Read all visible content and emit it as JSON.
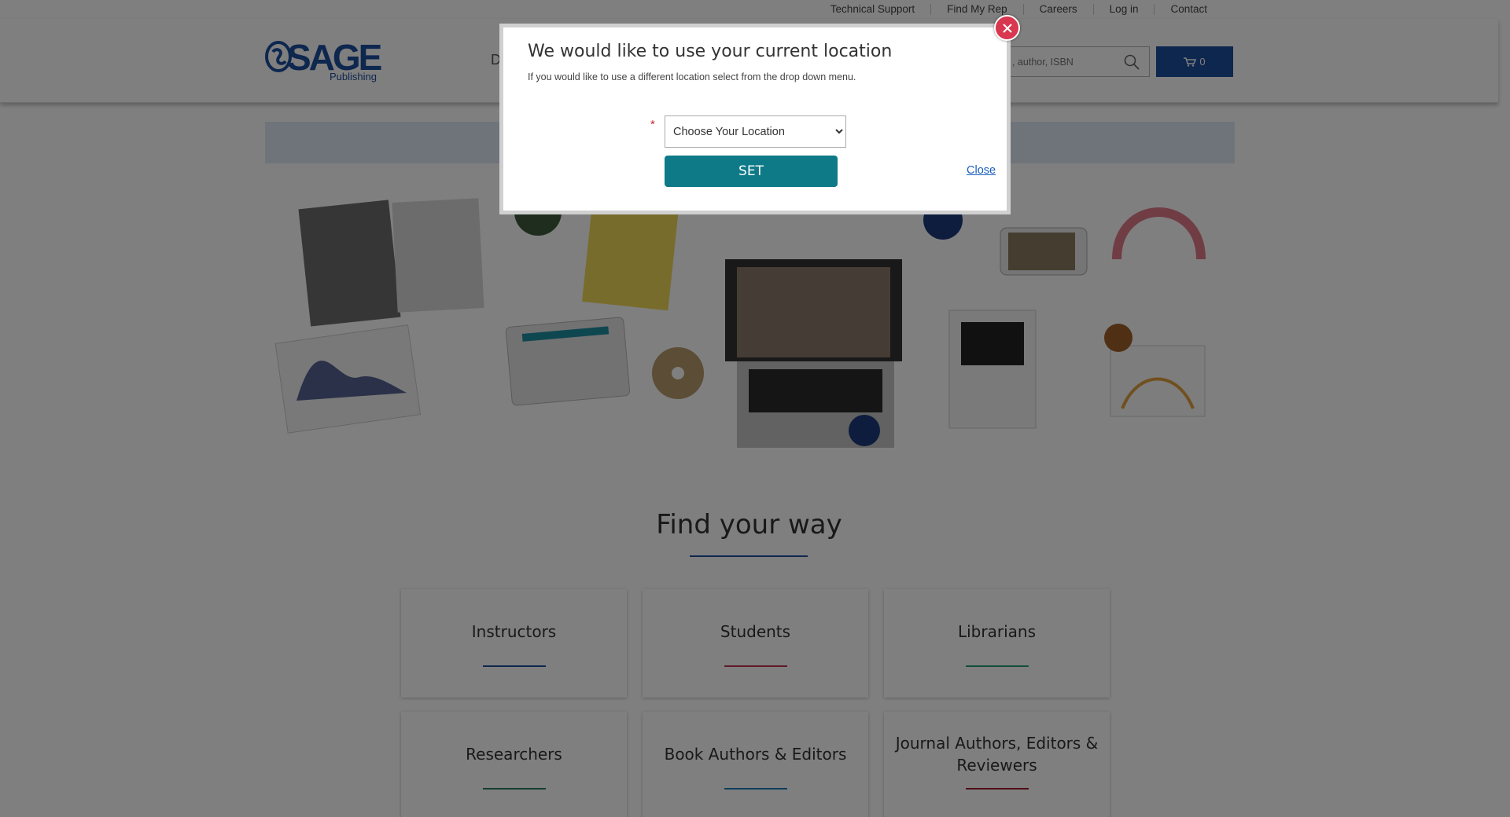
{
  "utility_nav": [
    "Technical Support",
    "Find My Rep",
    "Careers",
    "Log in",
    "Contact"
  ],
  "logo": {
    "word": "SAGE",
    "sub": "Publishing"
  },
  "nav": {
    "first_item_partial": "D"
  },
  "search": {
    "placeholder": ", author, ISBN"
  },
  "cart": {
    "count": "0"
  },
  "section": {
    "title": "Find your way"
  },
  "cards": [
    {
      "label": "Instructors",
      "color": "#1d4e9e"
    },
    {
      "label": "Students",
      "color": "#c0344a"
    },
    {
      "label": "Librarians",
      "color": "#2a9d7a"
    },
    {
      "label": "Researchers",
      "color": "#2d7a5a"
    },
    {
      "label": "Book Authors & Editors",
      "color": "#1f78b4"
    },
    {
      "label": "Journal Authors, Editors & Reviewers",
      "color": "#9e1b2e"
    }
  ],
  "modal": {
    "title": "We would like to use your current location",
    "subtitle": "If you would like to use a different location select from the drop down menu.",
    "required_mark": "*",
    "select_value": "Choose Your Location",
    "set_label": "SET",
    "close_label": "Close"
  },
  "icons": [
    "search-icon",
    "cart-icon",
    "close-icon"
  ]
}
